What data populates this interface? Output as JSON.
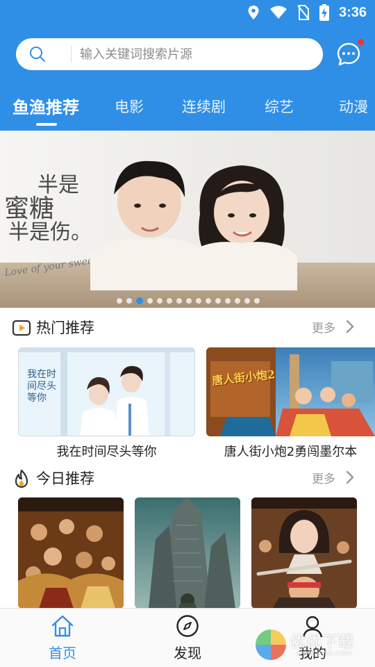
{
  "status_bar": {
    "time": "3:36",
    "icons": [
      "location-icon",
      "wifi-icon",
      "no-sim-icon",
      "battery-charging-icon"
    ]
  },
  "search": {
    "placeholder": "输入关键词搜索片源",
    "value": ""
  },
  "header": {
    "message_icon": "chat-bubble-icon",
    "has_unread": true,
    "tabs": [
      {
        "label": "鱼渔推荐",
        "active": true
      },
      {
        "label": "电影",
        "active": false
      },
      {
        "label": "连续剧",
        "active": false
      },
      {
        "label": "综艺",
        "active": false
      },
      {
        "label": "动漫",
        "active": false
      }
    ]
  },
  "banner": {
    "title_lines": [
      "半是",
      "蜜糖",
      "半是伤。"
    ],
    "subtitle": "Love of your sweet",
    "slide_count": 15,
    "active_slide": 3
  },
  "hot": {
    "title": "热门推荐",
    "more": "更多",
    "items": [
      {
        "title": "我在时间尽头等你",
        "poster_text": "我在时间尽头等你"
      },
      {
        "title": "唐人街小炮2勇闯墨尔本",
        "poster_text": "唐人街小炮2"
      }
    ]
  },
  "today": {
    "title": "今日推荐",
    "more": "更多",
    "items": [
      {
        "title": ""
      },
      {
        "title": ""
      },
      {
        "title": ""
      }
    ]
  },
  "bottom_nav": {
    "items": [
      {
        "label": "首页",
        "icon": "home-icon",
        "active": true
      },
      {
        "label": "发现",
        "icon": "compass-icon",
        "active": false
      },
      {
        "label": "我的",
        "icon": "user-icon",
        "active": false
      }
    ]
  },
  "watermark": {
    "text": "优优下载",
    "url": "www.yyxt.com"
  },
  "colors": {
    "primary": "#2f8fe6",
    "badge": "#f23030",
    "text_muted": "#999999"
  }
}
